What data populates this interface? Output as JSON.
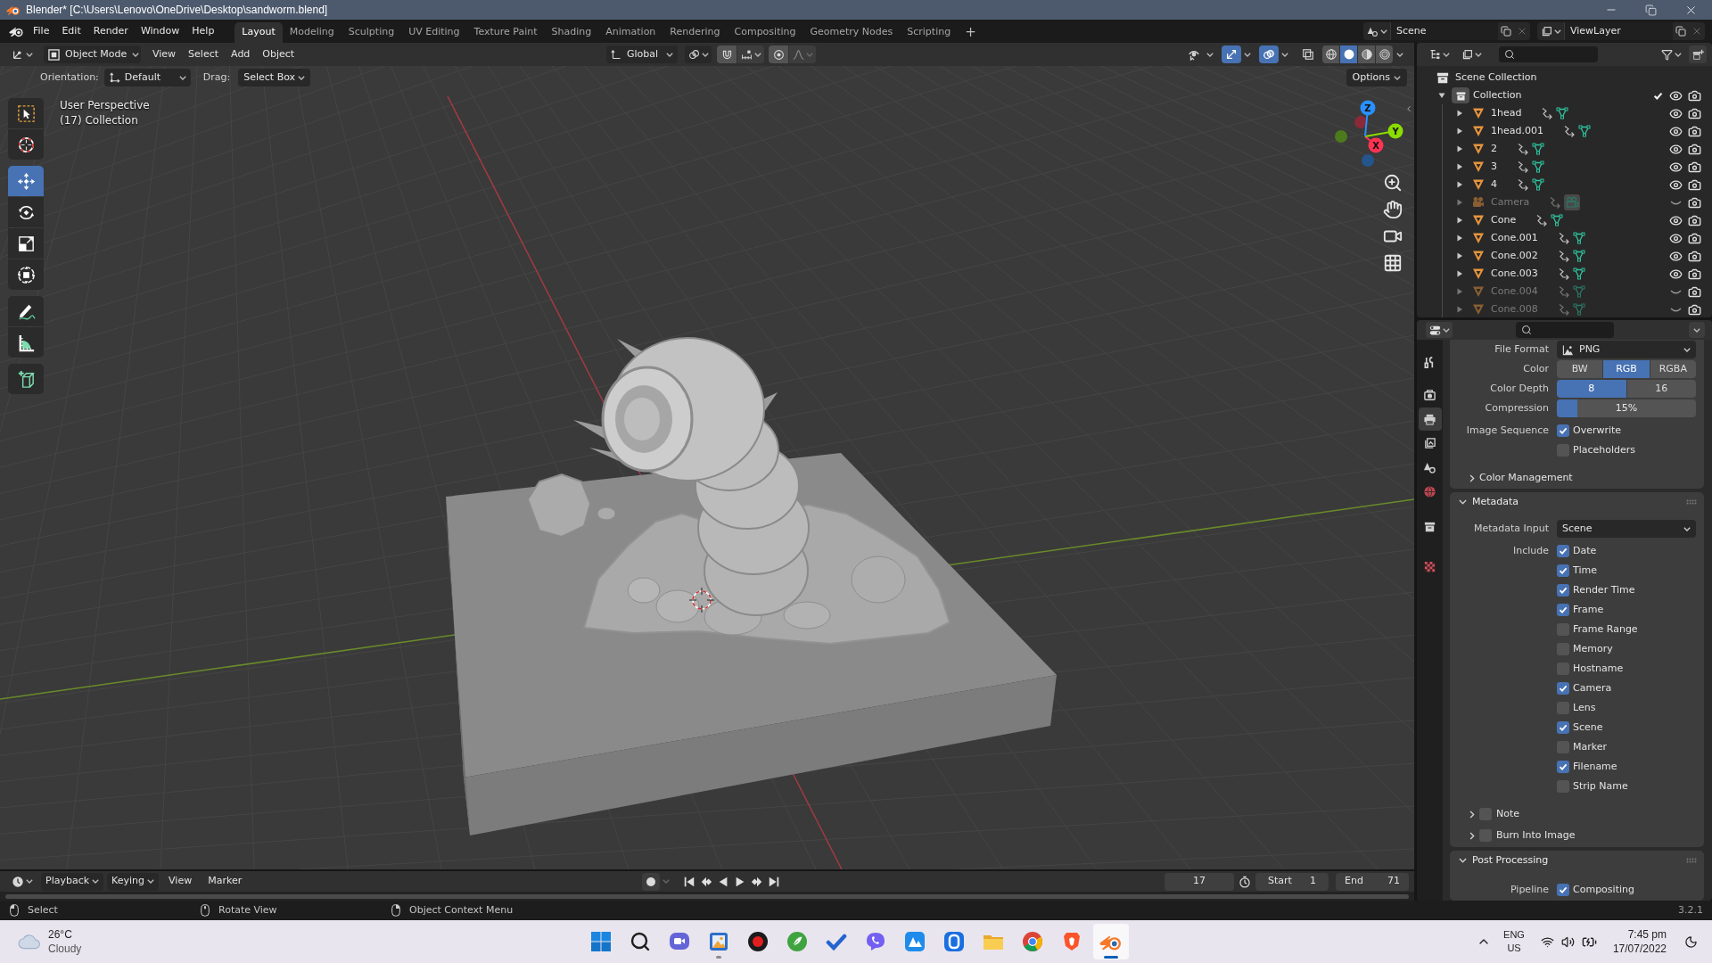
{
  "window": {
    "title": "Blender* [C:\\Users\\Lenovo\\OneDrive\\Desktop\\sandworm.blend]"
  },
  "menu": [
    "File",
    "Edit",
    "Render",
    "Window",
    "Help"
  ],
  "workspaces": [
    {
      "label": "Layout",
      "selected": true
    },
    {
      "label": "Modeling",
      "selected": false
    },
    {
      "label": "Sculpting",
      "selected": false
    },
    {
      "label": "UV Editing",
      "selected": false
    },
    {
      "label": "Texture Paint",
      "selected": false
    },
    {
      "label": "Shading",
      "selected": false
    },
    {
      "label": "Animation",
      "selected": false
    },
    {
      "label": "Rendering",
      "selected": false
    },
    {
      "label": "Compositing",
      "selected": false
    },
    {
      "label": "Geometry Nodes",
      "selected": false
    },
    {
      "label": "Scripting",
      "selected": false
    }
  ],
  "add_workspace": "+",
  "scene": "Scene",
  "view_layer": "ViewLayer",
  "viewport": {
    "mode": "Object Mode",
    "menus": [
      "View",
      "Select",
      "Add",
      "Object"
    ],
    "orientation": "Global",
    "toggles": [
      {
        "kind": "selectability",
        "on": false
      },
      {
        "kind": "gizmos",
        "on": true
      },
      {
        "kind": "overlays",
        "on": true
      },
      {
        "kind": "xray",
        "on": false
      }
    ],
    "shading": [
      {
        "kind": "wireframe",
        "selected": false
      },
      {
        "kind": "solid",
        "selected": true
      },
      {
        "kind": "material",
        "selected": false
      },
      {
        "kind": "rendered",
        "selected": false
      }
    ],
    "tool_settings": {
      "orientation_label": "Orientation:",
      "orientation": "Default",
      "drag_label": "Drag:",
      "drag": "Select Box",
      "options": "Options"
    },
    "info": [
      "User Perspective",
      "(17) Collection"
    ],
    "tool_groups": [
      [
        {
          "kind": "select_box",
          "selected": false
        },
        {
          "kind": "cursor",
          "selected": false
        }
      ],
      [
        {
          "kind": "move",
          "selected": true
        },
        {
          "kind": "rotate",
          "selected": false
        },
        {
          "kind": "scale",
          "selected": false
        },
        {
          "kind": "transform",
          "selected": false
        }
      ],
      [
        {
          "kind": "annotate",
          "selected": false
        },
        {
          "kind": "measure",
          "selected": false
        }
      ],
      [
        {
          "kind": "add_cube",
          "selected": false
        }
      ]
    ],
    "gizmo": {
      "x": "X",
      "y": "Y",
      "z": "Z"
    }
  },
  "outliner": {
    "root": "Scene Collection",
    "collections": [
      {
        "name": "Collection",
        "kind": "collection",
        "checked": true,
        "visible": true,
        "expanded": true,
        "children": [
          {
            "name": "1head",
            "kind": "mesh",
            "visible": true,
            "expanded": false
          },
          {
            "name": "1head.001",
            "kind": "mesh",
            "visible": true,
            "expanded": false
          },
          {
            "name": "2",
            "kind": "mesh",
            "visible": true,
            "expanded": false
          },
          {
            "name": "3",
            "kind": "mesh",
            "visible": true,
            "expanded": false
          },
          {
            "name": "4",
            "kind": "mesh",
            "visible": true,
            "expanded": false
          },
          {
            "name": "Camera",
            "kind": "camera",
            "visible": false,
            "expanded": false
          },
          {
            "name": "Cone",
            "kind": "mesh",
            "visible": true,
            "expanded": false
          },
          {
            "name": "Cone.001",
            "kind": "mesh",
            "visible": true,
            "expanded": false
          },
          {
            "name": "Cone.002",
            "kind": "mesh",
            "visible": true,
            "expanded": false
          },
          {
            "name": "Cone.003",
            "kind": "mesh",
            "visible": true,
            "expanded": false
          },
          {
            "name": "Cone.004",
            "kind": "mesh",
            "visible": false,
            "expanded": false
          },
          {
            "name": "Cone.008",
            "kind": "mesh",
            "visible": false,
            "expanded": false
          }
        ]
      }
    ]
  },
  "properties": {
    "tab_groups": [
      [
        {
          "kind": "tool",
          "selected": false
        }
      ],
      [
        {
          "kind": "render",
          "selected": false
        },
        {
          "kind": "output",
          "selected": true
        },
        {
          "kind": "view_layer",
          "selected": false
        },
        {
          "kind": "scene",
          "selected": false
        },
        {
          "kind": "world",
          "selected": false
        }
      ],
      [
        {
          "kind": "collection",
          "selected": false
        }
      ],
      [
        {
          "kind": "texture",
          "selected": false
        }
      ]
    ],
    "output": {
      "rows": [
        {
          "kind": "format",
          "label": "File Format",
          "value": "PNG"
        },
        {
          "kind": "segmented",
          "label": "Color",
          "options": [
            {
              "label": "BW",
              "selected": false
            },
            {
              "label": "RGB",
              "selected": true
            },
            {
              "label": "RGBA",
              "selected": false
            }
          ]
        },
        {
          "kind": "segmented",
          "label": "Color Depth",
          "options": [
            {
              "label": "8",
              "selected": true
            },
            {
              "label": "16",
              "selected": false
            }
          ]
        },
        {
          "kind": "slider",
          "label": "Compression",
          "value": "15%",
          "level": 0.15
        },
        {
          "kind": "checkboxes",
          "label": "Image Sequence",
          "options": [
            {
              "label": "Overwrite",
              "checked": true
            },
            {
              "label": "Placeholders",
              "checked": false
            }
          ]
        },
        {
          "kind": "subpanel",
          "label": "Color Management",
          "expanded": false
        }
      ]
    },
    "panels": [
      {
        "title": "Metadata",
        "expanded": true,
        "rows": [
          {
            "kind": "dropdown",
            "label": "Metadata Input",
            "value": "Scene"
          },
          {
            "kind": "checkboxes",
            "label": "Include",
            "options": [
              {
                "label": "Date",
                "checked": true
              },
              {
                "label": "Time",
                "checked": true
              },
              {
                "label": "Render Time",
                "checked": true
              },
              {
                "label": "Frame",
                "checked": true
              },
              {
                "label": "Frame Range",
                "checked": false
              },
              {
                "label": "Memory",
                "checked": false
              },
              {
                "label": "Hostname",
                "checked": false
              },
              {
                "label": "Camera",
                "checked": true
              },
              {
                "label": "Lens",
                "checked": false
              },
              {
                "label": "Scene",
                "checked": true
              },
              {
                "label": "Marker",
                "checked": false
              },
              {
                "label": "Filename",
                "checked": true
              },
              {
                "label": "Strip Name",
                "checked": false
              }
            ]
          },
          {
            "kind": "subpanel",
            "label": "Note",
            "expanded": false,
            "checked": false
          },
          {
            "kind": "subpanel",
            "label": "Burn Into Image",
            "expanded": false,
            "checked": false
          }
        ]
      },
      {
        "title": "Post Processing",
        "expanded": true,
        "rows": [
          {
            "kind": "checkboxes",
            "label": "Pipeline",
            "options": [
              {
                "label": "Compositing",
                "checked": true
              }
            ]
          }
        ]
      }
    ]
  },
  "timeline": {
    "menus": [
      {
        "label": "Playback",
        "kind": "popover"
      },
      {
        "label": "Keying",
        "kind": "popover"
      },
      {
        "label": "View",
        "kind": "menu"
      },
      {
        "label": "Marker",
        "kind": "menu"
      }
    ],
    "auto_keying": false,
    "current_frame": "17",
    "start_label": "Start",
    "start": "1",
    "end_label": "End",
    "end": "71"
  },
  "status_bar": {
    "hints": [
      {
        "kind": "left_click",
        "label": "Select"
      },
      {
        "kind": "middle_click",
        "label": "Rotate View"
      },
      {
        "kind": "right_click",
        "label": "Object Context Menu"
      }
    ],
    "version": "3.2.1"
  },
  "taskbar": {
    "weather": {
      "temperature": "26°C",
      "condition": "Cloudy"
    },
    "apps": [
      {
        "kind": "start",
        "running": false,
        "active": false
      },
      {
        "kind": "search",
        "running": false,
        "active": false
      },
      {
        "kind": "chat",
        "running": false,
        "active": false
      },
      {
        "kind": "photos",
        "running": true,
        "active": false
      },
      {
        "kind": "record",
        "running": false,
        "active": false
      },
      {
        "kind": "leaf",
        "running": false,
        "active": false
      },
      {
        "kind": "todo",
        "running": false,
        "active": false
      },
      {
        "kind": "bubble",
        "running": false,
        "active": false
      },
      {
        "kind": "triangles",
        "running": false,
        "active": false
      },
      {
        "kind": "square",
        "running": false,
        "active": false
      },
      {
        "kind": "folder",
        "running": false,
        "active": false
      },
      {
        "kind": "browser",
        "running": false,
        "active": false
      },
      {
        "kind": "shield",
        "running": false,
        "active": false
      },
      {
        "kind": "blender",
        "running": true,
        "active": true
      }
    ],
    "language": "ENG",
    "region": "US",
    "time": "7:45 pm",
    "date": "17/07/2022"
  }
}
